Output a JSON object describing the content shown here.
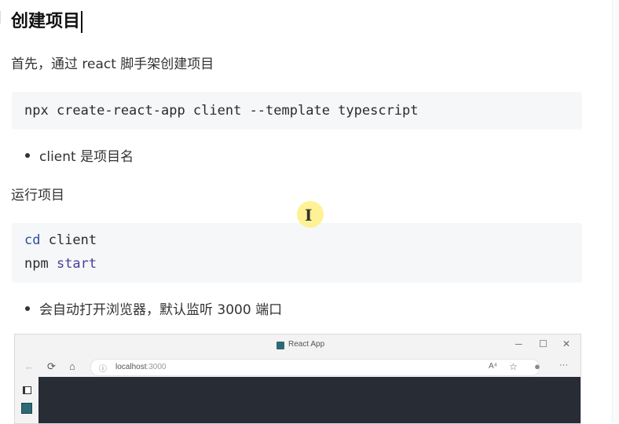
{
  "heading": "创建项目",
  "intro": "首先，通过 react 脚手架创建项目",
  "code1": {
    "line": "npx create-react-app client --template typescript"
  },
  "bullet1": "client 是项目名",
  "run_heading": "运行项目",
  "code2": {
    "line1_kw": "cd",
    "line1_rest": " client",
    "line2_cmd": "npm ",
    "line2_kw": "start"
  },
  "bullet2": "会自动打开浏览器，默认监听 3000 端口",
  "browser": {
    "tab_title": "React App",
    "minimize": "─",
    "maximize": "☐",
    "close": "✕",
    "url_host": "localhost",
    "url_port": ":3000",
    "read_aloud": "A⁴",
    "more": "···",
    "back_icon": "←",
    "refresh_icon": "⟳",
    "home_icon": "⌂",
    "info_icon": "ⓘ",
    "fav_icon": "☆",
    "profile_icon": "●"
  }
}
